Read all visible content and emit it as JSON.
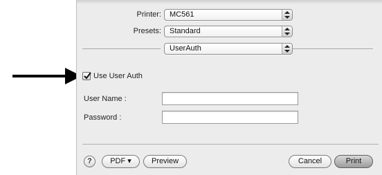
{
  "printer": {
    "label": "Printer:",
    "value": "MC561"
  },
  "presets": {
    "label": "Presets:",
    "value": "Standard"
  },
  "panel_menu": {
    "value": "UserAuth"
  },
  "user_auth": {
    "checkbox_label": "Use User Auth",
    "checked": true
  },
  "fields": {
    "user_name_label": "User Name :",
    "user_name_value": "",
    "password_label": "Password :",
    "password_value": ""
  },
  "footer": {
    "help": "?",
    "pdf_label": "PDF ▾",
    "preview_label": "Preview",
    "cancel_label": "Cancel",
    "print_label": "Print"
  }
}
